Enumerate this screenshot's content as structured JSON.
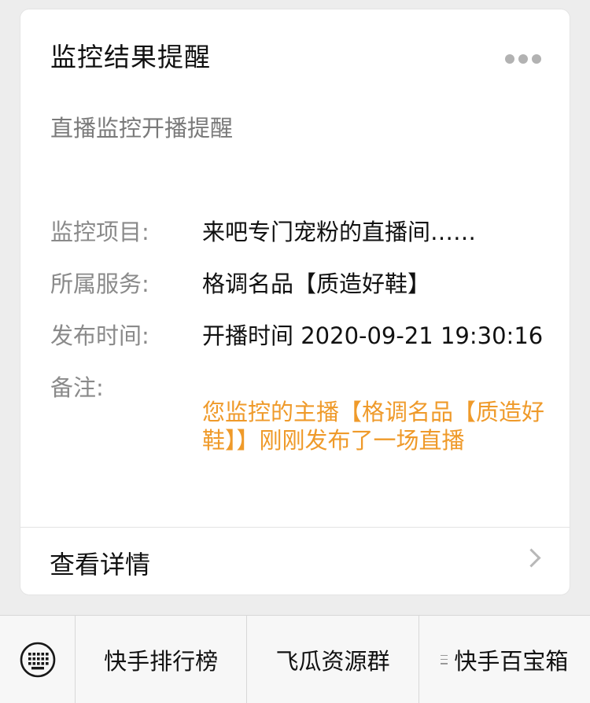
{
  "card": {
    "title": "监控结果提醒",
    "subtitle": "直播监控开播提醒",
    "fields": [
      {
        "label": "监控项目:",
        "value": "来吧专门宠粉的直播间……"
      },
      {
        "label": "所属服务:",
        "value": "格调名品【质造好鞋】"
      },
      {
        "label": "发布时间:",
        "value": "开播时间 2020-09-21 19:30:16"
      },
      {
        "label": "备注:",
        "value": "您监控的主播【格调名品【质造好鞋】】刚刚发布了一场直播"
      }
    ],
    "detail_label": "查看详情",
    "more_icon": "more-dots-icon",
    "accent_color": "#ef9a2a"
  },
  "bottom_menu": {
    "keyboard_icon": "keyboard-icon",
    "items": [
      "快手排行榜",
      "飞瓜资源群",
      "快手百宝箱"
    ]
  }
}
